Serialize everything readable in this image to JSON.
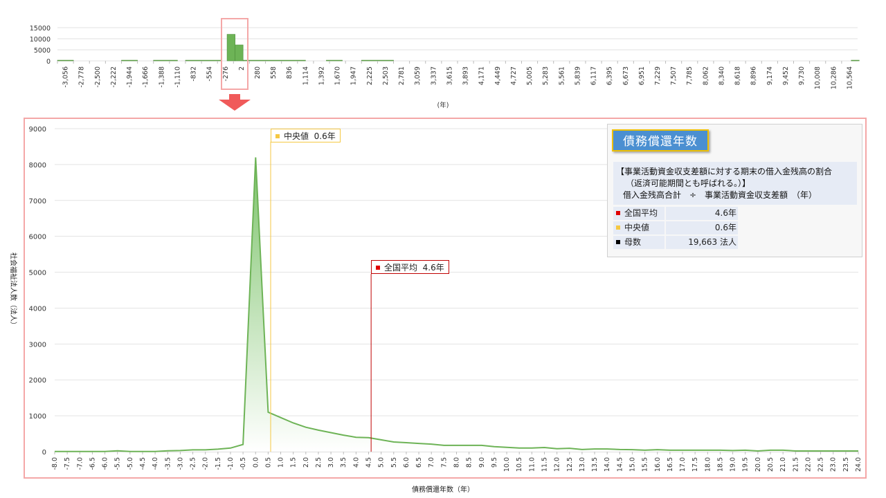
{
  "overview": {
    "y_ticks": [
      "15000",
      "10000",
      "5000",
      "0"
    ],
    "x_ticks": [
      "-3,056",
      "-2,778",
      "-2,500",
      "-2,222",
      "-1,944",
      "-1,666",
      "-1,388",
      "-1,110",
      "-832",
      "-554",
      "-276",
      "2",
      "280",
      "558",
      "836",
      "1,114",
      "1,392",
      "1,670",
      "1,947",
      "2,225",
      "2,503",
      "2,781",
      "3,059",
      "3,337",
      "3,615",
      "3,893",
      "4,171",
      "4,449",
      "4,727",
      "5,005",
      "5,283",
      "5,561",
      "5,839",
      "6,117",
      "6,395",
      "6,673",
      "6,951",
      "7,229",
      "7,507",
      "7,785",
      "8,062",
      "8,340",
      "8,618",
      "8,896",
      "9,174",
      "9,452",
      "9,730",
      "10,008",
      "10,286",
      "10,564"
    ],
    "xlabel": "(年)",
    "bars": [
      {
        "x": 0,
        "w": 1,
        "v": 300
      },
      {
        "x": 4,
        "w": 1,
        "v": 300
      },
      {
        "x": 6,
        "w": 1.5,
        "v": 300
      },
      {
        "x": 8,
        "w": 2.2,
        "v": 300
      },
      {
        "x": 10.6,
        "w": 0.5,
        "v": 12000
      },
      {
        "x": 11.1,
        "w": 0.5,
        "v": 7200
      },
      {
        "x": 11.6,
        "w": 3.9,
        "v": 300
      },
      {
        "x": 16.8,
        "w": 1,
        "v": 300
      },
      {
        "x": 19,
        "w": 2,
        "v": 300
      },
      {
        "x": 49.6,
        "w": 0.5,
        "v": 300
      }
    ],
    "color": "#6db356",
    "highlight_color": "#f4a7a7",
    "arrow_color": "#f05a5a"
  },
  "chart_data": {
    "type": "area",
    "title": "",
    "xlabel": "債務償還年数（年）",
    "ylabel": "社会福祉法人数（法人）",
    "xlim": [
      -8.0,
      24.0
    ],
    "ylim": [
      0,
      9000
    ],
    "y_ticks": [
      0,
      1000,
      2000,
      3000,
      4000,
      5000,
      6000,
      7000,
      8000,
      9000
    ],
    "x_step": 0.5,
    "x": [
      -8.0,
      -7.5,
      -7.0,
      -6.5,
      -6.0,
      -5.5,
      -5.0,
      -4.5,
      -4.0,
      -3.5,
      -3.0,
      -2.5,
      -2.0,
      -1.5,
      -1.0,
      -0.5,
      0.0,
      0.5,
      1.0,
      1.5,
      2.0,
      2.5,
      3.0,
      3.5,
      4.0,
      4.5,
      5.0,
      5.5,
      6.0,
      6.5,
      7.0,
      7.5,
      8.0,
      8.5,
      9.0,
      9.5,
      10.0,
      10.5,
      11.0,
      11.5,
      12.0,
      12.5,
      13.0,
      13.5,
      14.0,
      14.5,
      15.0,
      15.5,
      16.0,
      16.5,
      17.0,
      17.5,
      18.0,
      18.5,
      19.0,
      19.5,
      20.0,
      20.5,
      21.0,
      21.5,
      22.0,
      22.5,
      23.0,
      23.5,
      24.0
    ],
    "series": [
      {
        "values": [
          5,
          5,
          5,
          5,
          5,
          25,
          5,
          5,
          5,
          25,
          30,
          50,
          50,
          70,
          100,
          200,
          8200,
          1100,
          950,
          800,
          680,
          600,
          530,
          460,
          400,
          390,
          330,
          270,
          250,
          230,
          210,
          175,
          175,
          175,
          175,
          140,
          120,
          100,
          100,
          115,
          80,
          95,
          60,
          75,
          75,
          60,
          55,
          40,
          55,
          40,
          40,
          40,
          40,
          40,
          30,
          40,
          20,
          40,
          40,
          20,
          20,
          20,
          20,
          20,
          20
        ]
      }
    ],
    "median": {
      "value": 0.6,
      "label": "中央値",
      "text": "0.6年",
      "color": "#f5c842"
    },
    "mean": {
      "value": 4.6,
      "label": "全国平均",
      "text": "4.6年",
      "color": "#c00000"
    },
    "line_color": "#6db356",
    "fill_top": "#7cc36a",
    "fill_bottom": "#ffffff",
    "grid": true,
    "legend": "none"
  },
  "info": {
    "title": "債務償還年数",
    "desc_line1": "【事業活動資金収支差額に対する期末の借入金残高の割合",
    "desc_line2": "（返済可能期間とも呼ばれる。）】",
    "desc_line3": "借入金残高合計　÷　事業活動資金収支差額　（年）",
    "rows": [
      {
        "label": "全国平均",
        "value": "4.6年",
        "color": "#e00000"
      },
      {
        "label": "中央値",
        "value": "0.6年",
        "color": "#f5c842"
      },
      {
        "label": "母数",
        "value": "19,663  法人",
        "color": "#000000"
      }
    ]
  }
}
